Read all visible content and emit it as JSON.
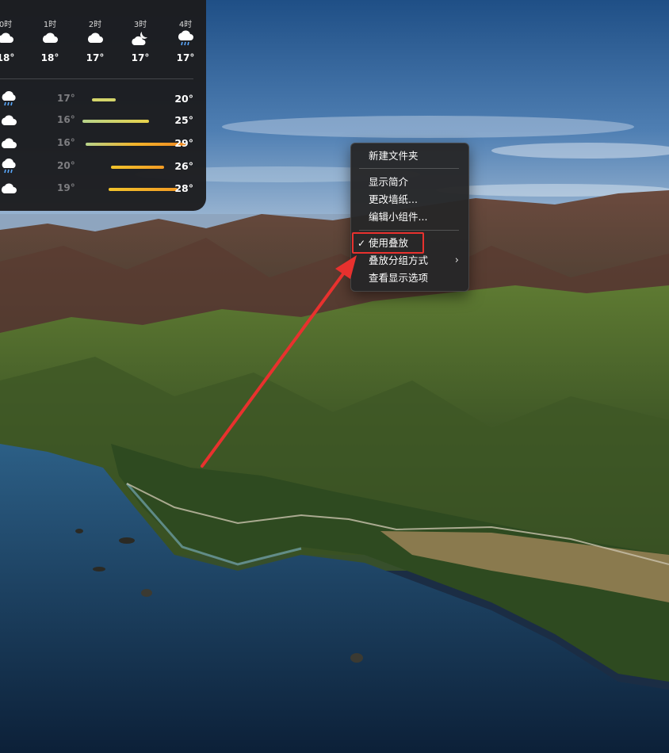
{
  "weather": {
    "hourly": [
      {
        "hour": "0时",
        "icon": "cloud-icon",
        "temp": "18°"
      },
      {
        "hour": "1时",
        "icon": "cloud-icon",
        "temp": "18°"
      },
      {
        "hour": "2时",
        "icon": "cloud-icon",
        "temp": "17°"
      },
      {
        "hour": "3时",
        "icon": "cloud-moon-icon",
        "temp": "17°"
      },
      {
        "hour": "4时",
        "icon": "cloud-rain-icon",
        "temp": "17°"
      }
    ],
    "daily": [
      {
        "icon": "cloud-rain-icon",
        "low": "17°",
        "high": "20°"
      },
      {
        "icon": "cloud-icon",
        "low": "16°",
        "high": "25°"
      },
      {
        "icon": "cloud-icon",
        "low": "16°",
        "high": "29°"
      },
      {
        "icon": "cloud-rain-icon",
        "low": "20°",
        "high": "26°"
      },
      {
        "icon": "cloud-icon",
        "low": "19°",
        "high": "28°"
      }
    ]
  },
  "context_menu": {
    "items": [
      "新建文件夹",
      "显示简介",
      "更改墙纸...",
      "编辑小组件...",
      "使用叠放",
      "叠放分组方式",
      "查看显示选项"
    ],
    "checked_item": "使用叠放"
  },
  "annotation": {
    "color": "#e8312e"
  }
}
